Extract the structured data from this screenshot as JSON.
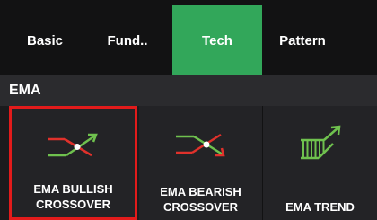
{
  "tabs": [
    {
      "label": "Basic",
      "active": false
    },
    {
      "label": "Fund..",
      "active": false
    },
    {
      "label": "Tech",
      "active": true
    },
    {
      "label": "Pattern",
      "active": false
    }
  ],
  "section": {
    "title": "EMA"
  },
  "cards": [
    {
      "label": "EMA BULLISH\nCROSSOVER",
      "icon": "bullish-crossover-icon",
      "selected": true
    },
    {
      "label": "EMA BEARISH\nCROSSOVER",
      "icon": "bearish-crossover-icon",
      "selected": false
    },
    {
      "label": "EMA TREND",
      "icon": "trend-icon",
      "selected": false
    }
  ],
  "colors": {
    "accent_green": "#32a75a",
    "selection_red": "#e21b1b",
    "line_red": "#e0312b",
    "line_green": "#6fc14e",
    "background": "#1b1b1d"
  }
}
